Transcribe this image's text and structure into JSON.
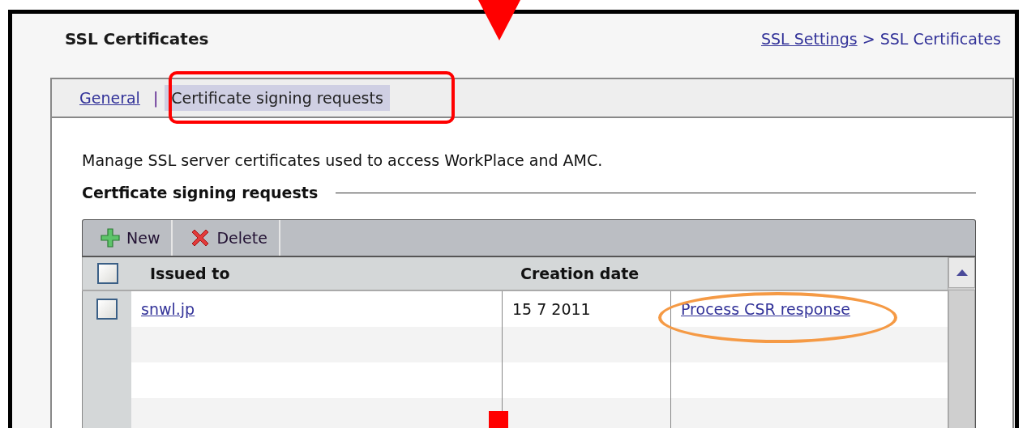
{
  "page": {
    "title": "SSL Certificates",
    "breadcrumb": [
      {
        "label": "SSL Settings",
        "kind": "link"
      },
      {
        "label": "> SSL Certificates",
        "kind": "text"
      }
    ]
  },
  "tabs": [
    {
      "label": "General",
      "selected": false
    },
    {
      "label": "Certificate signing requests",
      "selected": true
    }
  ],
  "tab_separator": "|",
  "description": "Manage SSL server certificates used to access WorkPlace and AMC.",
  "section_title": "Certficate signing requests",
  "toolbar": [
    {
      "label": "New",
      "kind": "add"
    },
    {
      "label": "Delete",
      "kind": "delete"
    }
  ],
  "table": {
    "columns": [
      "Issued to",
      "Creation date"
    ],
    "header_checked": false,
    "rows": [
      {
        "checked": false,
        "issued_to": "snwl.jp",
        "creation_date": "15 7 2011",
        "action": "Process CSR response"
      }
    ]
  }
}
